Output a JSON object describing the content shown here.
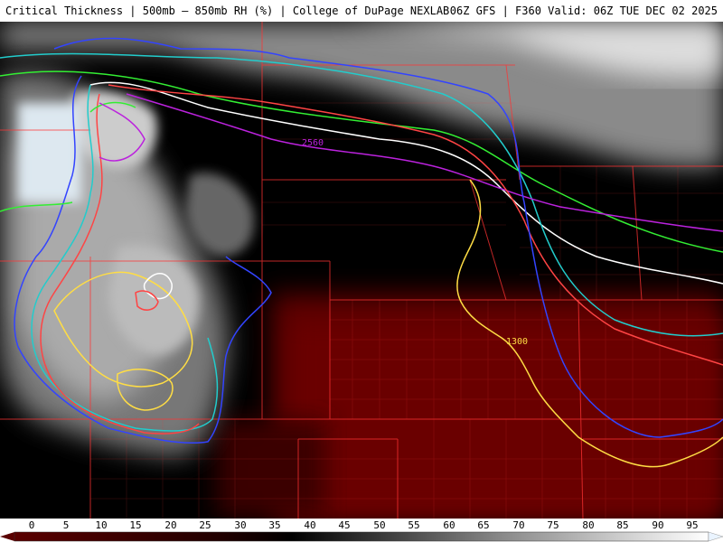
{
  "header": {
    "title_left": "Critical Thickness | 500mb – 850mb RH (%) | College of DuPage NEXLAB",
    "title_right": "06Z GFS | F360 Valid: 06Z TUE DEC 02 2025"
  },
  "map": {
    "contour_labels": [
      "2560",
      "1300"
    ],
    "colors": {
      "rh_high": "#ffffff",
      "rh_mid": "#777777",
      "rh_low": "#000000",
      "rh_dry": "#5a0000",
      "borders": "#ff3333",
      "line_white": "#ffffff",
      "line_green": "#33ee33",
      "line_cyan": "#22cccc",
      "line_purple": "#bb22dd",
      "line_red": "#ff4444",
      "line_blue": "#3344ff",
      "line_yellow": "#ffdd44"
    }
  },
  "legend": {
    "ticks": [
      "0",
      "5",
      "10",
      "15",
      "20",
      "25",
      "30",
      "35",
      "40",
      "45",
      "50",
      "55",
      "60",
      "65",
      "70",
      "75",
      "80",
      "85",
      "90",
      "95"
    ]
  }
}
